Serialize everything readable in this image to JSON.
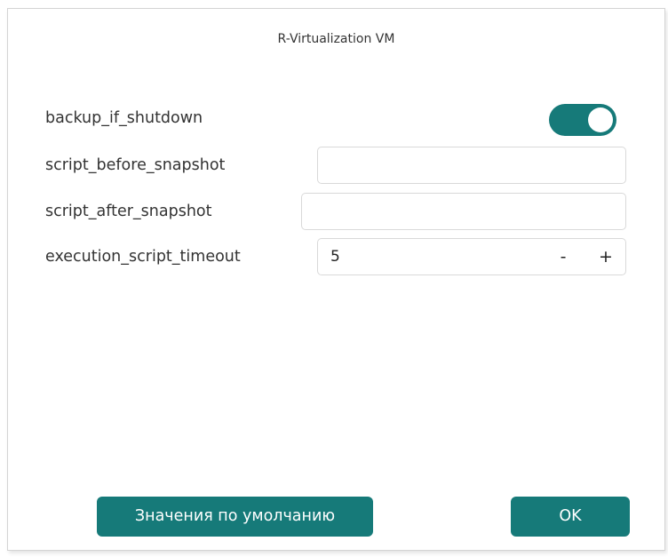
{
  "dialog": {
    "title": "R-Virtualization VM"
  },
  "settings": {
    "backup_if_shutdown": {
      "label": "backup_if_shutdown",
      "enabled": true
    },
    "script_before_snapshot": {
      "label": "script_before_snapshot",
      "value": ""
    },
    "script_after_snapshot": {
      "label": "script_after_snapshot",
      "value": ""
    },
    "execution_script_timeout": {
      "label": "execution_script_timeout",
      "value": "5",
      "decrement_label": "-",
      "increment_label": "+"
    }
  },
  "buttons": {
    "defaults_label": "Значения по умолчанию",
    "ok_label": "OK"
  },
  "colors": {
    "accent": "#167a79"
  }
}
